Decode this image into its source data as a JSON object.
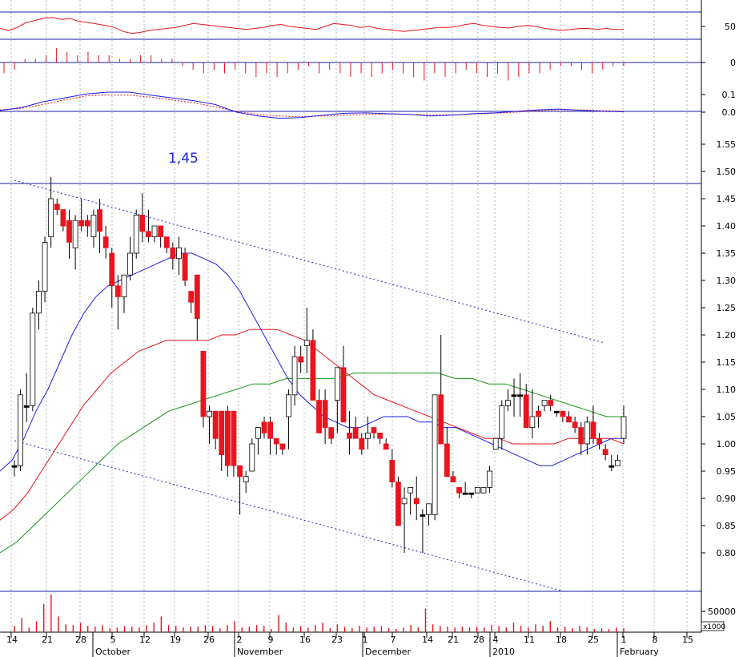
{
  "chart_data": {
    "type": "candlestick",
    "annotation": "1,45",
    "resistance_level": 1.45,
    "price_ylim": [
      0.75,
      1.6
    ],
    "price_ticks": [
      "1.55",
      "1.50",
      "1.45",
      "1.40",
      "1.35",
      "1.30",
      "1.25",
      "1.20",
      "1.15",
      "1.10",
      "1.05",
      "1.00",
      "0.95",
      "0.90",
      "0.85",
      "0.80"
    ],
    "rsi_ticks": [
      "50"
    ],
    "hist_ticks": [
      "0"
    ],
    "macd_ticks": [
      "0.1",
      "0.0"
    ],
    "volume_ticks": [
      "50000"
    ],
    "volume_unit": "x1000",
    "date_ticks": [
      "14",
      "21",
      "28",
      "5",
      "12",
      "19",
      "26",
      "2",
      "9",
      "16",
      "23",
      "1",
      "7",
      "14",
      "21",
      "28",
      "4",
      "11",
      "18",
      "25",
      "1",
      "8",
      "15"
    ],
    "month_labels": [
      "October",
      "November",
      "December",
      "2010",
      "February"
    ],
    "colors": {
      "up": "#ffffff",
      "down": "#e8141e",
      "flat": "#000000",
      "ma_short": "#1e1ee6",
      "ma_mid": "#e8141e",
      "ma_long": "#149614",
      "guide": "#1e1ea0"
    },
    "candles": [
      [
        0.96,
        0.97,
        0.94,
        0.96
      ],
      [
        0.96,
        1.1,
        0.95,
        1.09
      ],
      [
        1.07,
        1.13,
        1.04,
        1.07
      ],
      [
        1.07,
        1.25,
        1.06,
        1.24
      ],
      [
        1.24,
        1.3,
        1.21,
        1.28
      ],
      [
        1.28,
        1.38,
        1.26,
        1.37
      ],
      [
        1.38,
        1.49,
        1.36,
        1.45
      ],
      [
        1.44,
        1.45,
        1.42,
        1.43
      ],
      [
        1.43,
        1.43,
        1.39,
        1.4
      ],
      [
        1.41,
        1.43,
        1.34,
        1.37
      ],
      [
        1.36,
        1.42,
        1.32,
        1.41
      ],
      [
        1.41,
        1.45,
        1.39,
        1.4
      ],
      [
        1.41,
        1.42,
        1.38,
        1.4
      ],
      [
        1.38,
        1.43,
        1.36,
        1.42
      ],
      [
        1.43,
        1.45,
        1.35,
        1.39
      ],
      [
        1.38,
        1.4,
        1.34,
        1.36
      ],
      [
        1.35,
        1.36,
        1.25,
        1.29
      ],
      [
        1.29,
        1.31,
        1.21,
        1.27
      ],
      [
        1.27,
        1.31,
        1.24,
        1.31
      ],
      [
        1.31,
        1.38,
        1.3,
        1.35
      ],
      [
        1.35,
        1.43,
        1.34,
        1.42
      ],
      [
        1.42,
        1.46,
        1.37,
        1.39
      ],
      [
        1.39,
        1.43,
        1.37,
        1.38
      ],
      [
        1.38,
        1.4,
        1.37,
        1.4
      ],
      [
        1.4,
        1.4,
        1.36,
        1.38
      ],
      [
        1.38,
        1.38,
        1.35,
        1.36
      ],
      [
        1.36,
        1.37,
        1.32,
        1.34
      ],
      [
        1.34,
        1.38,
        1.31,
        1.36
      ],
      [
        1.35,
        1.36,
        1.29,
        1.3
      ],
      [
        1.28,
        1.28,
        1.24,
        1.26
      ],
      [
        1.31,
        1.31,
        1.19,
        1.23
      ],
      [
        1.17,
        1.17,
        1.03,
        1.05
      ],
      [
        1.05,
        1.07,
        1.0,
        1.06
      ],
      [
        1.06,
        1.06,
        0.99,
        1.01
      ],
      [
        1.06,
        1.06,
        0.95,
        0.98
      ],
      [
        1.06,
        1.07,
        0.94,
        0.96
      ],
      [
        1.06,
        1.06,
        0.94,
        0.96
      ],
      [
        0.96,
        0.96,
        0.87,
        0.94
      ],
      [
        0.93,
        0.95,
        0.91,
        0.94
      ],
      [
        0.95,
        1.01,
        0.95,
        1.0
      ],
      [
        1.01,
        1.02,
        0.98,
        1.03
      ],
      [
        1.04,
        1.05,
        1.01,
        1.02
      ],
      [
        1.04,
        1.05,
        0.98,
        1.01
      ],
      [
        1.01,
        1.01,
        0.98,
        1.0
      ],
      [
        1.0,
        1.0,
        0.98,
        0.99
      ],
      [
        1.05,
        1.1,
        0.99,
        1.09
      ],
      [
        1.09,
        1.18,
        1.07,
        1.16
      ],
      [
        1.16,
        1.18,
        1.13,
        1.15
      ],
      [
        1.18,
        1.25,
        1.13,
        1.19
      ],
      [
        1.19,
        1.21,
        1.08,
        1.08
      ],
      [
        1.08,
        1.1,
        1.02,
        1.02
      ],
      [
        1.08,
        1.1,
        1.0,
        1.03
      ],
      [
        1.03,
        1.03,
        1.0,
        1.01
      ],
      [
        1.08,
        1.14,
        1.02,
        1.14
      ],
      [
        1.14,
        1.18,
        1.04,
        1.04
      ],
      [
        1.02,
        1.06,
        0.98,
        1.01
      ],
      [
        1.03,
        1.05,
        1.01,
        1.01
      ],
      [
        1.01,
        1.02,
        0.98,
        0.99
      ],
      [
        1.01,
        1.05,
        0.99,
        1.02
      ],
      [
        1.03,
        1.03,
        1.01,
        1.02
      ],
      [
        1.02,
        1.02,
        1.0,
        1.01
      ],
      [
        1.0,
        1.01,
        0.99,
        0.99
      ],
      [
        0.97,
        0.99,
        0.92,
        0.93
      ],
      [
        0.93,
        0.94,
        0.85,
        0.85
      ],
      [
        0.89,
        0.92,
        0.8,
        0.9
      ],
      [
        0.91,
        0.92,
        0.87,
        0.92
      ],
      [
        0.9,
        0.94,
        0.86,
        0.89
      ],
      [
        0.87,
        0.88,
        0.8,
        0.87
      ],
      [
        0.87,
        0.89,
        0.85,
        0.89
      ],
      [
        0.87,
        1.09,
        0.86,
        1.09
      ],
      [
        1.09,
        1.2,
        1.0,
        1.0
      ],
      [
        1.0,
        1.03,
        0.94,
        0.94
      ],
      [
        0.94,
        0.95,
        0.93,
        0.93
      ],
      [
        0.92,
        0.92,
        0.9,
        0.91
      ],
      [
        0.91,
        0.93,
        0.91,
        0.91
      ],
      [
        0.91,
        0.91,
        0.9,
        0.91
      ],
      [
        0.91,
        0.92,
        0.91,
        0.92
      ],
      [
        0.91,
        0.92,
        0.91,
        0.92
      ],
      [
        0.92,
        0.96,
        0.91,
        0.95
      ],
      [
        0.99,
        1.01,
        0.99,
        1.01
      ],
      [
        1.01,
        1.08,
        0.99,
        1.07
      ],
      [
        1.07,
        1.1,
        1.06,
        1.08
      ],
      [
        1.09,
        1.12,
        1.05,
        1.09
      ],
      [
        1.09,
        1.13,
        1.05,
        1.09
      ],
      [
        1.09,
        1.11,
        1.03,
        1.03
      ],
      [
        1.03,
        1.1,
        1.01,
        1.05
      ],
      [
        1.06,
        1.07,
        1.03,
        1.05
      ],
      [
        1.07,
        1.08,
        1.06,
        1.08
      ],
      [
        1.08,
        1.09,
        1.06,
        1.07
      ],
      [
        1.06,
        1.06,
        1.05,
        1.06
      ],
      [
        1.06,
        1.06,
        1.04,
        1.05
      ],
      [
        1.05,
        1.06,
        1.04,
        1.04
      ],
      [
        1.04,
        1.05,
        1.02,
        1.03
      ],
      [
        1.03,
        1.04,
        0.98,
        1.0
      ],
      [
        1.0,
        1.05,
        0.98,
        1.04
      ],
      [
        1.04,
        1.07,
        1.0,
        1.01
      ],
      [
        1.01,
        1.02,
        0.99,
        1.0
      ],
      [
        0.99,
        1.0,
        0.97,
        0.98
      ],
      [
        0.96,
        0.98,
        0.95,
        0.96
      ],
      [
        0.96,
        0.98,
        0.96,
        0.97
      ],
      [
        1.01,
        1.07,
        1.0,
        1.05
      ]
    ],
    "ma_short": [
      0.95,
      0.97,
      1.01,
      1.06,
      1.1,
      1.15,
      1.2,
      1.24,
      1.27,
      1.29,
      1.3,
      1.31,
      1.32,
      1.33,
      1.34,
      1.35,
      1.35,
      1.34,
      1.33,
      1.31,
      1.28,
      1.24,
      1.2,
      1.16,
      1.12,
      1.09,
      1.07,
      1.05,
      1.04,
      1.03,
      1.03,
      1.04,
      1.05,
      1.05,
      1.05,
      1.04,
      1.04,
      1.03,
      1.03,
      1.02,
      1.01,
      1.0,
      0.99,
      0.98,
      0.97,
      0.96,
      0.96,
      0.97,
      0.98,
      0.99,
      1.0,
      1.01,
      1.01
    ],
    "ma_mid": [
      0.86,
      0.88,
      0.91,
      0.95,
      0.99,
      1.03,
      1.07,
      1.1,
      1.13,
      1.15,
      1.17,
      1.18,
      1.19,
      1.19,
      1.19,
      1.19,
      1.2,
      1.2,
      1.21,
      1.21,
      1.21,
      1.2,
      1.19,
      1.17,
      1.15,
      1.13,
      1.11,
      1.09,
      1.08,
      1.07,
      1.06,
      1.05,
      1.04,
      1.03,
      1.02,
      1.01,
      1.01,
      1.0,
      1.0,
      1.0,
      1.0,
      1.01,
      1.01,
      1.01,
      1.01,
      1.0
    ],
    "ma_long": [
      0.8,
      0.82,
      0.85,
      0.88,
      0.91,
      0.94,
      0.97,
      1.0,
      1.02,
      1.04,
      1.06,
      1.07,
      1.08,
      1.09,
      1.1,
      1.11,
      1.11,
      1.12,
      1.12,
      1.12,
      1.12,
      1.13,
      1.13,
      1.13,
      1.13,
      1.13,
      1.13,
      1.12,
      1.12,
      1.11,
      1.11,
      1.1,
      1.09,
      1.08,
      1.07,
      1.06,
      1.05,
      1.05
    ],
    "rsi": [
      46,
      42,
      48,
      58,
      62,
      67,
      68,
      64,
      66,
      60,
      58,
      55,
      52,
      48,
      40,
      36,
      38,
      42,
      44,
      46,
      48,
      52,
      56,
      54,
      52,
      50,
      48,
      46,
      44,
      46,
      48,
      52,
      54,
      50,
      48,
      46,
      44,
      50,
      56,
      54,
      52,
      48,
      50,
      46,
      44,
      42,
      40,
      42,
      44,
      46,
      48,
      48,
      50,
      54,
      56,
      52,
      50,
      48,
      47,
      50,
      52,
      50,
      46,
      44,
      42,
      44,
      46,
      46,
      44,
      46,
      44,
      44
    ],
    "hist": [
      -3,
      -2,
      1,
      1,
      2,
      4,
      3,
      2,
      3,
      2,
      2,
      1,
      1,
      2,
      2,
      1,
      1,
      -1,
      -2,
      -3,
      -2,
      -3,
      -2,
      -3,
      -4,
      -3,
      -4,
      -3,
      -2,
      -1,
      -3,
      -2,
      -3,
      -4,
      -3,
      -4,
      -3,
      -2,
      -3,
      -4,
      -5,
      -3,
      -4,
      -3,
      -2,
      -3,
      -4,
      -3,
      -5,
      -4,
      -3,
      -3,
      -2,
      -1,
      -1,
      -2,
      -3,
      -2,
      -1,
      -1
    ],
    "macd_line": [
      0.002,
      0.01,
      0.025,
      0.035,
      0.045,
      0.05,
      0.05,
      0.042,
      0.035,
      0.028,
      0.018,
      -0.002,
      -0.012,
      -0.018,
      -0.016,
      -0.01,
      -0.005,
      -0.004,
      -0.006,
      -0.008,
      -0.012,
      -0.01,
      -0.006,
      -0.004,
      0.0,
      0.004,
      0.006,
      0.003,
      0.0,
      -0.001
    ],
    "macd_signal": [
      0.004,
      0.008,
      0.018,
      0.03,
      0.04,
      0.043,
      0.042,
      0.037,
      0.03,
      0.022,
      0.012,
      0.0,
      -0.008,
      -0.012,
      -0.014,
      -0.012,
      -0.01,
      -0.008,
      -0.007,
      -0.008,
      -0.009,
      -0.009,
      -0.007,
      -0.005,
      -0.002,
      0.002,
      0.004,
      0.004,
      0.002,
      0.0
    ],
    "volume": [
      8,
      18,
      6,
      14,
      36,
      48,
      20,
      10,
      9,
      12,
      8,
      7,
      9,
      5,
      6,
      8,
      7,
      6,
      9,
      12,
      20,
      9,
      8,
      6,
      7,
      7,
      9,
      8,
      5,
      9,
      14,
      6,
      7,
      9,
      8,
      4,
      22,
      12,
      6,
      8,
      6,
      9,
      12,
      5,
      10,
      7,
      5,
      8,
      6,
      7,
      8,
      5,
      4,
      6,
      9,
      6,
      30,
      10,
      8,
      7,
      6,
      7,
      6,
      7,
      6,
      9,
      8,
      6,
      12,
      8,
      6,
      10,
      8,
      14,
      6,
      7,
      5,
      8,
      6,
      4,
      5,
      4,
      6,
      5
    ]
  }
}
